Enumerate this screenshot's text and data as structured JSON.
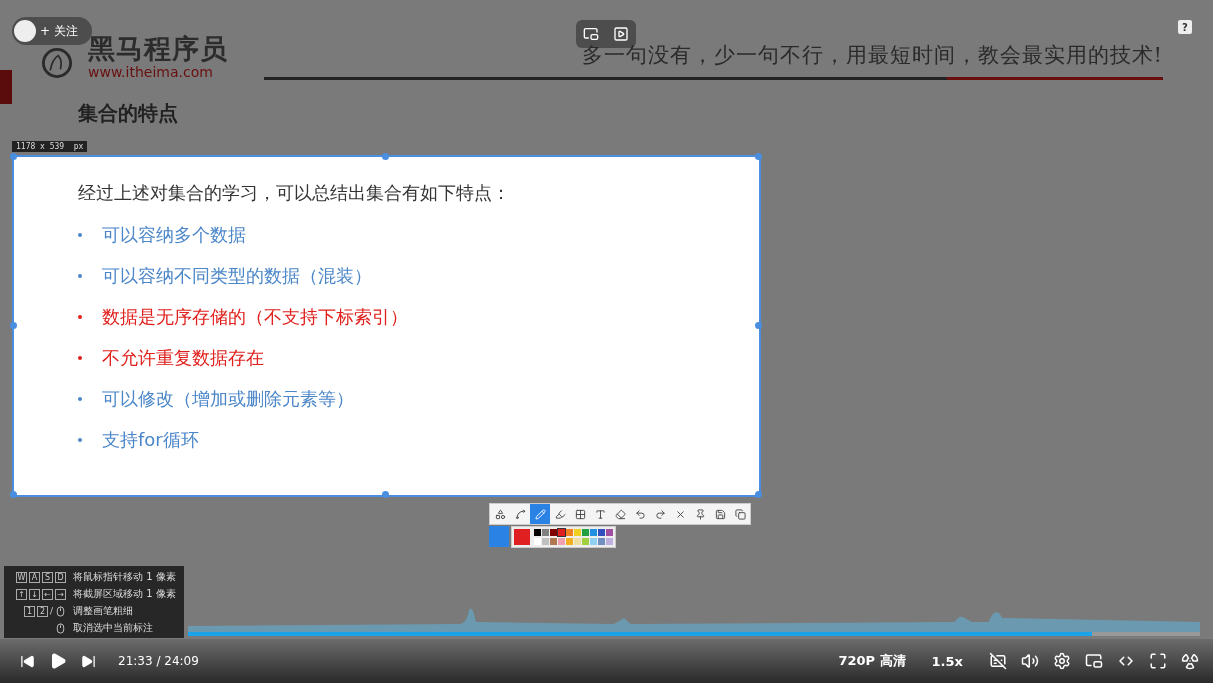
{
  "uploader": {
    "follow": "+ 关注"
  },
  "help": "?",
  "slide": {
    "brand": "黑马程序员",
    "url": "www.itheima.com",
    "slogan": "多一句没有，少一句不行，用最短时间，教会最实用的技术!",
    "heading": "集合的特点"
  },
  "selection": {
    "size": "1178 x 539  px",
    "intro": "经过上述对集合的学习，可以总结出集合有如下特点：",
    "items": [
      {
        "text": "可以容纳多个数据",
        "color": "#4a86c8"
      },
      {
        "text": "可以容纳不同类型的数据（混装）",
        "color": "#4a86c8"
      },
      {
        "text": "数据是无序存储的（不支持下标索引）",
        "color": "#e0201c"
      },
      {
        "text": "不允许重复数据存在",
        "color": "#e0201c"
      },
      {
        "text": "可以修改（增加或删除元素等）",
        "color": "#4a86c8"
      },
      {
        "text": "支持for循环",
        "color": "#4a86c8"
      }
    ]
  },
  "tools": [
    {
      "kind": "shape",
      "selected": false
    },
    {
      "kind": "curve",
      "selected": false
    },
    {
      "kind": "pen",
      "selected": true
    },
    {
      "kind": "marker",
      "selected": false
    },
    {
      "kind": "mosaic",
      "selected": false
    },
    {
      "kind": "text",
      "selected": false
    },
    {
      "kind": "eraser",
      "selected": false
    },
    {
      "kind": "undo",
      "selected": false
    },
    {
      "kind": "redo",
      "selected": false
    },
    {
      "kind": "close",
      "selected": false
    },
    {
      "kind": "pin",
      "selected": false
    },
    {
      "kind": "save",
      "selected": false
    },
    {
      "kind": "copy",
      "selected": false
    }
  ],
  "palette": {
    "colors": [
      {
        "color": "#000000",
        "selected": false
      },
      {
        "color": "#808080",
        "selected": false
      },
      {
        "color": "#800000",
        "selected": false
      },
      {
        "color": "#e02020",
        "selected": true
      },
      {
        "color": "#f08020",
        "selected": false
      },
      {
        "color": "#f0d020",
        "selected": false
      },
      {
        "color": "#20a040",
        "selected": false
      },
      {
        "color": "#2090e0",
        "selected": false
      },
      {
        "color": "#3050c0",
        "selected": false
      },
      {
        "color": "#a050a0",
        "selected": false
      },
      {
        "color": "#ffffff",
        "selected": false
      },
      {
        "color": "#c0c0c0",
        "selected": false
      },
      {
        "color": "#b07850",
        "selected": false
      },
      {
        "color": "#f0a0b0",
        "selected": false
      },
      {
        "color": "#f0b020",
        "selected": false
      },
      {
        "color": "#f0e0a0",
        "selected": false
      },
      {
        "color": "#a0d040",
        "selected": false
      },
      {
        "color": "#90d0f0",
        "selected": false
      },
      {
        "color": "#7090c0",
        "selected": false
      },
      {
        "color": "#c0b0e0",
        "selected": false
      }
    ]
  },
  "shortcuts": [
    {
      "keys": [
        "W",
        "A",
        "S",
        "D"
      ],
      "mouse": false,
      "hint": "将鼠标指针移动 1 像素"
    },
    {
      "keys": [
        "↑",
        "↓",
        "←",
        "→"
      ],
      "mouse": false,
      "hint": "将截屏区域移动 1 像素"
    },
    {
      "keys": [
        "1",
        "2"
      ],
      "separator": "/",
      "mouse": true,
      "hint": "调整画笔粗细"
    },
    {
      "mouse": true,
      "hint": "取消选中当前标注"
    }
  ],
  "player": {
    "progress": {
      "level": 0.893
    },
    "time": "21:33 / 24:09",
    "quality": "720P 高清",
    "speed": "1.5x"
  }
}
